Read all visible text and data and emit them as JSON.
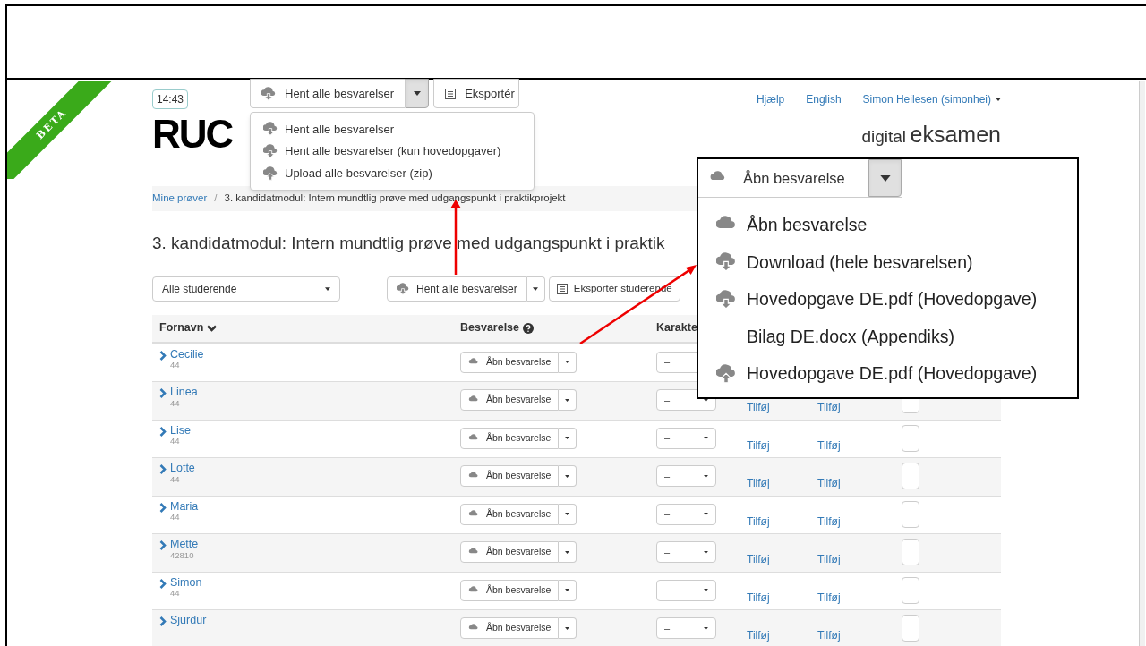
{
  "beta_ribbon": "BETA",
  "top_bar": {
    "time": "14:43",
    "download_button": "Hent alle besvarelser",
    "export_button": "Eksportér",
    "links": [
      "Hjælp",
      "English"
    ],
    "user": "Simon Heilesen (simonhei)"
  },
  "logo": "RUC",
  "brand": {
    "light": "digital",
    "bold": "eksamen"
  },
  "breadcrumb_separator": "/",
  "breadcrumb": [
    "Mine prøver",
    "3. kandidatmodul: Intern mundtlig prøve med udgangspunkt i praktikprojekt"
  ],
  "page_title": "3. kandidatmodul: Intern mundtlig prøve med udgangspunkt i praktik",
  "filter_select": "Alle studerende",
  "toolbar": {
    "download_button": "Hent alle besvarelser",
    "export_button": "Eksportér studerende"
  },
  "table": {
    "columns": [
      "Fornavn",
      "Besvarelse",
      "Karakte"
    ],
    "rows": [
      {
        "first_name": "Cecilie",
        "id": "44",
        "submission_button": "Åbn besvarelse",
        "grade": "–"
      },
      {
        "first_name": "Linea",
        "id": "44",
        "submission_button": "Åbn besvarelse",
        "grade": "–",
        "column_4": "Tilføj",
        "column_5": "Tilføj"
      },
      {
        "first_name": "Lise",
        "id": "44",
        "submission_button": "Åbn besvarelse",
        "grade": "–",
        "column_4": "Tilføj",
        "column_5": "Tilføj"
      },
      {
        "first_name": "Lotte",
        "id": "44",
        "submission_button": "Åbn besvarelse",
        "grade": "–",
        "column_4": "Tilføj",
        "column_5": "Tilføj"
      },
      {
        "first_name": "Maria",
        "id": "44",
        "submission_button": "Åbn besvarelse",
        "grade": "–",
        "column_4": "Tilføj",
        "column_5": "Tilføj"
      },
      {
        "first_name": "Mette",
        "id": "42810",
        "submission_button": "Åbn besvarelse",
        "grade": "–",
        "column_4": "Tilføj",
        "column_5": "Tilføj"
      },
      {
        "first_name": "Simon",
        "id": "44",
        "submission_button": "Åbn besvarelse",
        "grade": "–",
        "column_4": "Tilføj",
        "column_5": "Tilføj"
      },
      {
        "first_name": "Sjurdur",
        "submission_button": "Åbn besvarelse",
        "grade": "–",
        "column_4": "Tilføj",
        "column_5": "Tilføj"
      }
    ]
  },
  "download_menu": {
    "items": [
      {
        "label": "Hent alle besvarelser",
        "kind": "download"
      },
      {
        "label": "Hent alle besvarelser (kun hovedopgaver)",
        "kind": "download"
      },
      {
        "label": "Upload alle besvarelser (zip)",
        "kind": "upload"
      }
    ]
  },
  "submission_callout": {
    "button": "Åbn besvarelse",
    "items": [
      {
        "label": "Åbn besvarelse",
        "kind": "open"
      },
      {
        "label": "Download (hele besvarelsen)",
        "kind": "download"
      },
      {
        "label": "Hovedopgave DE.pdf (Hovedopgave)",
        "kind": "download"
      },
      {
        "label": "Bilag DE.docx (Appendiks)",
        "kind": "plain"
      },
      {
        "label": "Hovedopgave DE.pdf (Hovedopgave)",
        "kind": "upload"
      }
    ]
  }
}
